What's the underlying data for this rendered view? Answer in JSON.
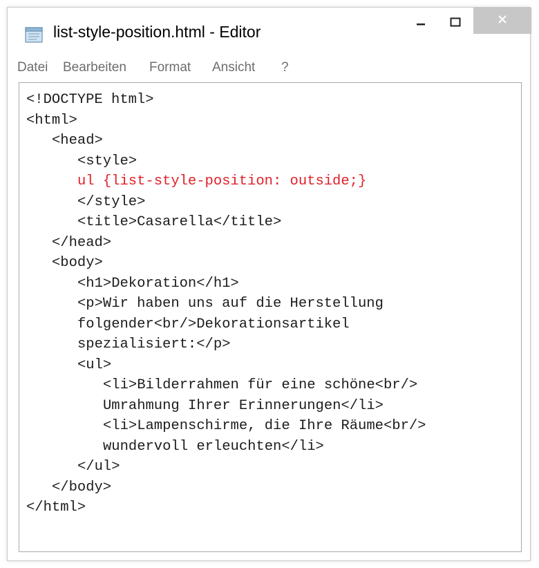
{
  "window": {
    "title": "list-style-position.html - Editor"
  },
  "icons": {
    "app": "notepad-icon",
    "minimize": "minimize-icon",
    "maximize": "maximize-icon",
    "close": "close-icon"
  },
  "menu": {
    "items": [
      "Datei",
      "Bearbeiten",
      "Format",
      "Ansicht",
      "?"
    ]
  },
  "colors": {
    "code_text": "#1c1c1c",
    "highlight": "#e0202a",
    "close_button_bg": "#c7c7c7",
    "menu_text": "#6d6d6d"
  },
  "editor": {
    "lines": [
      {
        "text": "<!DOCTYPE html>",
        "indent": 0,
        "highlight": false
      },
      {
        "text": "<html>",
        "indent": 0,
        "highlight": false
      },
      {
        "text": "<head>",
        "indent": 1,
        "highlight": false
      },
      {
        "text": "<style>",
        "indent": 2,
        "highlight": false
      },
      {
        "text": "ul {list-style-position: outside;}",
        "indent": 2,
        "highlight": true
      },
      {
        "text": "</style>",
        "indent": 2,
        "highlight": false
      },
      {
        "text": "<title>Casarella</title>",
        "indent": 2,
        "highlight": false
      },
      {
        "text": "</head>",
        "indent": 1,
        "highlight": false
      },
      {
        "text": "<body>",
        "indent": 1,
        "highlight": false
      },
      {
        "text": "<h1>Dekoration</h1>",
        "indent": 2,
        "highlight": false
      },
      {
        "text": "<p>Wir haben uns auf die Herstellung",
        "indent": 2,
        "highlight": false
      },
      {
        "text": "folgender<br/>Dekorationsartikel",
        "indent": 2,
        "highlight": false
      },
      {
        "text": "spezialisiert:</p>",
        "indent": 2,
        "highlight": false
      },
      {
        "text": "<ul>",
        "indent": 2,
        "highlight": false
      },
      {
        "text": "<li>Bilderrahmen für eine schöne<br/>",
        "indent": 3,
        "highlight": false
      },
      {
        "text": "Umrahmung Ihrer Erinnerungen</li>",
        "indent": 3,
        "highlight": false
      },
      {
        "text": "<li>Lampenschirme, die Ihre Räume<br/>",
        "indent": 3,
        "highlight": false
      },
      {
        "text": "wundervoll erleuchten</li>",
        "indent": 3,
        "highlight": false
      },
      {
        "text": "</ul>",
        "indent": 2,
        "highlight": false
      },
      {
        "text": "</body>",
        "indent": 1,
        "highlight": false
      },
      {
        "text": "</html>",
        "indent": 0,
        "highlight": false
      }
    ]
  }
}
